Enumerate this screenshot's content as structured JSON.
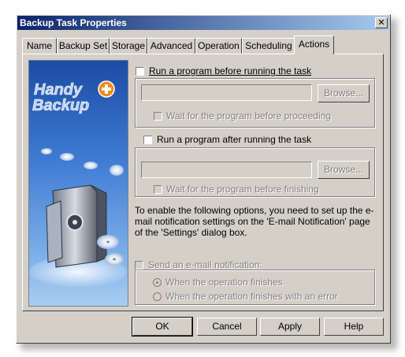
{
  "window": {
    "title": "Backup Task Properties",
    "close_glyph": "✕"
  },
  "tabs": [
    {
      "label": "Name"
    },
    {
      "label": "Backup Set"
    },
    {
      "label": "Storage"
    },
    {
      "label": "Advanced"
    },
    {
      "label": "Operation"
    },
    {
      "label": "Scheduling"
    },
    {
      "label": "Actions",
      "active": true
    }
  ],
  "logo": {
    "line1": "Handy",
    "line2": "Backup"
  },
  "before": {
    "label": "Run a program before running the task",
    "path_value": "",
    "browse": "Browse...",
    "wait_label": "Wait for the program before proceeding"
  },
  "after": {
    "label": "Run a program after running the task",
    "path_value": "",
    "browse": "Browse...",
    "wait_label": "Wait for the program before finishing"
  },
  "info_text": "To enable the following options, you need to set up the e-mail notification settings on the 'E-mail Notification' page of the 'Settings' dialog box.",
  "email": {
    "label": "Send an e-mail notification:",
    "option1": "When the operation finishes",
    "option2": "When the operation finishes with an error"
  },
  "buttons": {
    "ok": "OK",
    "cancel": "Cancel",
    "apply": "Apply",
    "help": "Help"
  },
  "icons": {
    "close": "close-icon",
    "logo": "handy-backup-logo"
  }
}
